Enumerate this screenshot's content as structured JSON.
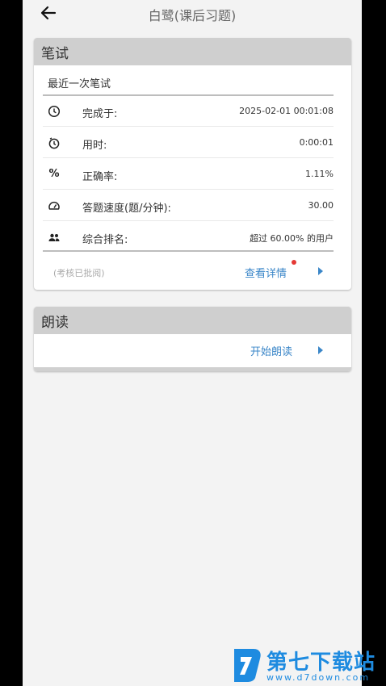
{
  "header": {
    "title": "白鹭(课后习题)"
  },
  "written": {
    "section_title": "笔试",
    "subtitle": "最近一次笔试",
    "rows": [
      {
        "icon": "clock-icon",
        "label": "完成于:",
        "value": "2025-02-01 00:01:08"
      },
      {
        "icon": "timer-icon",
        "label": "用时:",
        "value": "0:00:01"
      },
      {
        "icon": "percent-icon",
        "label": "正确率:",
        "value": "1.11%"
      },
      {
        "icon": "speedometer-icon",
        "label": "答题速度(题/分钟):",
        "value": "30.00"
      },
      {
        "icon": "people-icon",
        "label": "综合排名:",
        "value": "超过 60.00% 的用户"
      }
    ],
    "status": "(考核已批阅)",
    "details_link": "查看详情"
  },
  "reading": {
    "section_title": "朗读",
    "start_link": "开始朗读"
  },
  "watermark": {
    "name": "第七下载站",
    "url": "www.d7down.com"
  },
  "colors": {
    "accent": "#3a86c8",
    "header_bg": "#cfcfcf",
    "badge": "#e53935",
    "watermark": "#1e8be0"
  }
}
